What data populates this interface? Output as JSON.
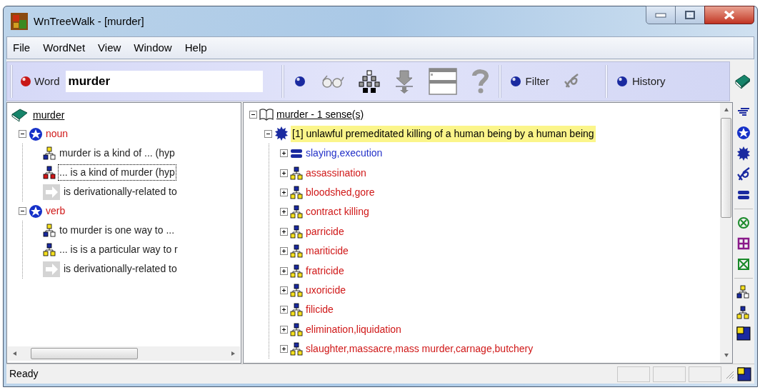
{
  "window": {
    "title": "WnTreeWalk - [murder]"
  },
  "menu": [
    {
      "label": "File"
    },
    {
      "label": "WordNet"
    },
    {
      "label": "View"
    },
    {
      "label": "Window"
    },
    {
      "label": "Help"
    }
  ],
  "toolbar": {
    "word_label": "Word",
    "word_value": "murder",
    "filter_label": "Filter",
    "history_label": "History"
  },
  "left_tree": {
    "label": "murder",
    "children": [
      {
        "label": "noun",
        "kind": "pos",
        "expanded": true,
        "children": [
          {
            "label": "murder is a kind of ... (hyp",
            "kind": "hypernym",
            "selected": false
          },
          {
            "label": "... is a kind of murder (hyp",
            "kind": "hyponym",
            "selected": true
          },
          {
            "label": "is derivationally-related to",
            "kind": "derivation",
            "selected": false
          }
        ]
      },
      {
        "label": "verb",
        "kind": "pos",
        "expanded": true,
        "children": [
          {
            "label": "to murder is one way to ...",
            "kind": "hypernym",
            "selected": false
          },
          {
            "label": "... is is a particular way to r",
            "kind": "troponym",
            "selected": false
          },
          {
            "label": "is derivationally-related to",
            "kind": "derivation",
            "selected": false
          }
        ]
      }
    ]
  },
  "right_tree": {
    "label": "murder - 1 sense(s)",
    "expanded": true,
    "sense": {
      "label": "[1] unlawful premeditated killing of a human being by a human being",
      "expanded": true,
      "selected": true,
      "children": [
        {
          "label": "slaying,execution",
          "kind": "synonym",
          "expanded": false
        },
        {
          "label": "assassination",
          "kind": "hyponym",
          "expanded": false
        },
        {
          "label": "bloodshed,gore",
          "kind": "hyponym",
          "expanded": false
        },
        {
          "label": "contract killing",
          "kind": "hyponym",
          "expanded": false
        },
        {
          "label": "parricide",
          "kind": "hyponym",
          "expanded": false
        },
        {
          "label": "mariticide",
          "kind": "hyponym",
          "expanded": false
        },
        {
          "label": "fratricide",
          "kind": "hyponym",
          "expanded": false
        },
        {
          "label": "uxoricide",
          "kind": "hyponym",
          "expanded": false
        },
        {
          "label": "filicide",
          "kind": "hyponym",
          "expanded": false
        },
        {
          "label": "elimination,liquidation",
          "kind": "hyponym",
          "expanded": false
        },
        {
          "label": "slaughter,massacre,mass murder,carnage,butchery",
          "kind": "hyponym",
          "expanded": false
        }
      ]
    }
  },
  "status_bar": {
    "text": "Ready"
  }
}
